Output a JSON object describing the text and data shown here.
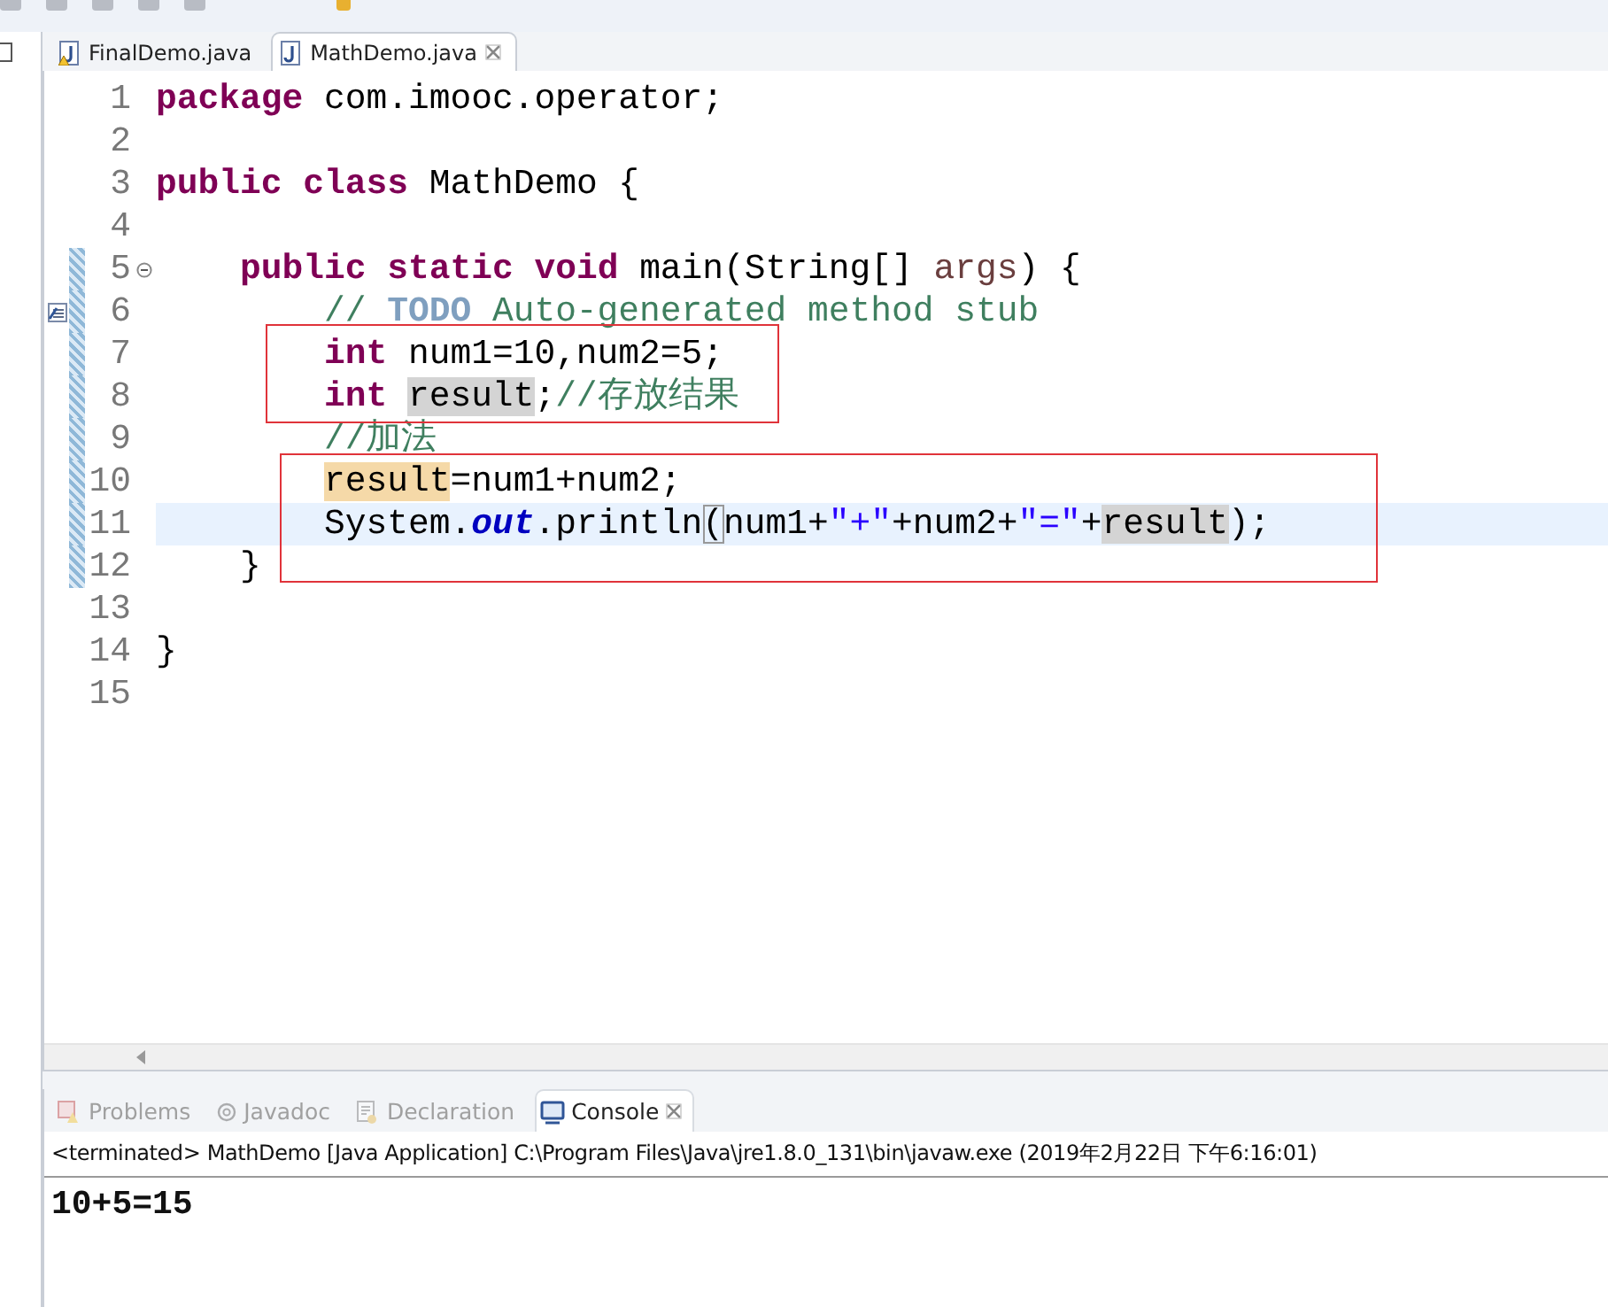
{
  "editor_tabs": [
    {
      "label": "FinalDemo.java",
      "selected": false,
      "warning": true,
      "closable": false
    },
    {
      "label": "MathDemo.java",
      "selected": true,
      "warning": false,
      "closable": true
    }
  ],
  "lines": [
    {
      "number": "1",
      "kind": "plain",
      "current": false,
      "changed": false,
      "tokens": [
        {
          "text": "package",
          "kind": "keyword"
        },
        {
          "text": " com.imooc.operator;",
          "kind": "text"
        }
      ]
    },
    {
      "number": "2",
      "kind": "plain",
      "current": false,
      "changed": false
    },
    {
      "number": "3",
      "kind": "plain",
      "current": false,
      "changed": false,
      "tokens": [
        {
          "text": "public",
          "kind": "keyword"
        },
        {
          "text": " class",
          "kind": "keyword"
        },
        {
          "text": " MathDemo {",
          "kind": "text"
        }
      ]
    },
    {
      "number": "4",
      "kind": "plain",
      "current": false,
      "changed": false
    },
    {
      "number": "5",
      "kind": "fold",
      "current": false,
      "changed": true,
      "tokens": [
        {
          "text": "    public",
          "kind": "keyword"
        },
        {
          "text": " static",
          "kind": "keyword"
        },
        {
          "text": " void",
          "kind": "keyword"
        },
        {
          "text": " main(String[] ",
          "kind": "text"
        },
        {
          "text": "args",
          "kind": "param"
        },
        {
          "text": ") {",
          "kind": "text"
        }
      ]
    },
    {
      "number": "6",
      "kind": "task",
      "current": false,
      "changed": true,
      "tokens": [
        {
          "text": "        // ",
          "kind": "comment"
        },
        {
          "text": "TODO",
          "kind": "task"
        },
        {
          "text": " Auto-generated method stub",
          "kind": "comment"
        }
      ]
    },
    {
      "number": "7",
      "kind": "plain",
      "current": false,
      "changed": true,
      "tokens": [
        {
          "text": "        int",
          "kind": "keyword"
        },
        {
          "text": " num1=10,num2=5;",
          "kind": "text"
        }
      ]
    },
    {
      "number": "8",
      "kind": "plain",
      "current": false,
      "changed": true,
      "tokens": [
        {
          "text": "        int ",
          "kind": "keyword"
        },
        {
          "text": "result",
          "kind": "occurrence"
        },
        {
          "text": ";",
          "kind": "text"
        },
        {
          "text": "//存放结果",
          "kind": "comment"
        }
      ]
    },
    {
      "number": "9",
      "kind": "plain",
      "current": false,
      "changed": true,
      "tokens": [
        {
          "text": "        //加法",
          "kind": "comment"
        }
      ]
    },
    {
      "number": "10",
      "kind": "plain",
      "current": false,
      "changed": true,
      "tokens": [
        {
          "text": "        result",
          "kind": "write-occurrence"
        },
        {
          "text": "=num1+num2;",
          "kind": "text"
        }
      ]
    },
    {
      "number": "11",
      "kind": "plain",
      "current": true,
      "changed": true,
      "tokens": [
        {
          "text": "        System.",
          "kind": "text"
        },
        {
          "text": "out",
          "kind": "field"
        },
        {
          "text": ".println",
          "kind": "text"
        },
        {
          "text": "(",
          "kind": "bracket"
        },
        {
          "text": "num1+",
          "kind": "text"
        },
        {
          "text": "\"+\"",
          "kind": "string"
        },
        {
          "text": "+num2+",
          "kind": "text"
        },
        {
          "text": "\"=\"",
          "kind": "string"
        },
        {
          "text": "+",
          "kind": "text"
        },
        {
          "text": "result",
          "kind": "occurrence"
        },
        {
          "text": ");",
          "kind": "text"
        }
      ]
    },
    {
      "number": "12",
      "kind": "plain",
      "current": false,
      "changed": true,
      "tokens": [
        {
          "text": "    }",
          "kind": "text"
        }
      ]
    },
    {
      "number": "13",
      "kind": "plain",
      "current": false,
      "changed": false
    },
    {
      "number": "14",
      "kind": "plain",
      "current": false,
      "changed": false,
      "tokens": [
        {
          "text": "}",
          "kind": "text"
        }
      ]
    },
    {
      "number": "15",
      "kind": "plain",
      "current": false,
      "changed": false
    }
  ],
  "view_tabs": [
    {
      "label": "Problems",
      "selected": false,
      "closable": false
    },
    {
      "label": "Javadoc",
      "selected": false,
      "closable": false
    },
    {
      "label": "Declaration",
      "selected": false,
      "closable": false
    },
    {
      "label": "Console",
      "selected": true,
      "closable": true
    }
  ],
  "console": {
    "header": "<terminated> MathDemo [Java Application] C:\\Program Files\\Java\\jre1.8.0_131\\bin\\javaw.exe (2019年2月22日 下午6:16:01)",
    "output": "10+5=15"
  }
}
